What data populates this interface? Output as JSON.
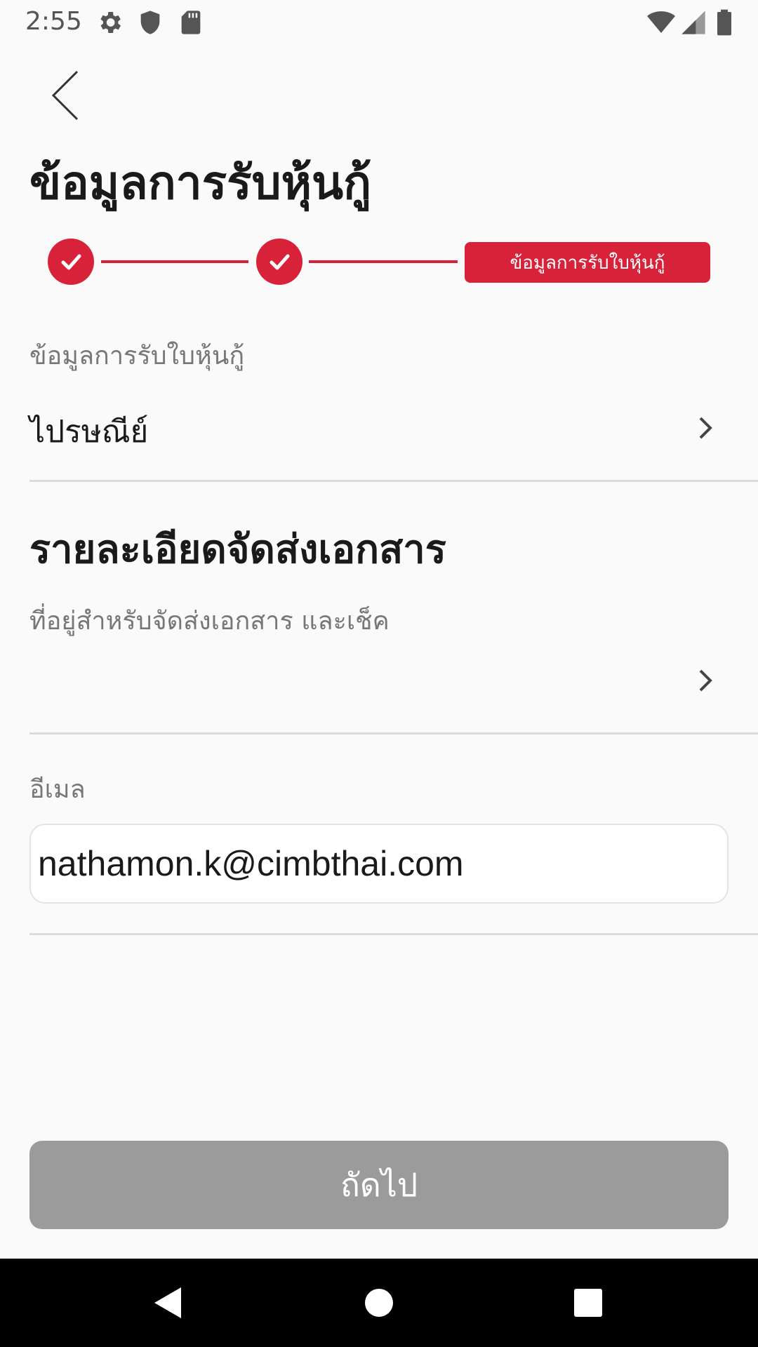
{
  "status_bar": {
    "time": "2:55",
    "left_icons": [
      "gear-icon",
      "shield-icon",
      "sd-card-icon"
    ],
    "right_icons": [
      "wifi-icon",
      "signal-icon",
      "battery-icon"
    ]
  },
  "header": {
    "back_icon": "chevron-left-icon",
    "title": "ข้อมูลการรับหุ้นกู้"
  },
  "stepper": {
    "completed_steps": 2,
    "current_step_label": "ข้อมูลการรับใบหุ้นกู้",
    "accent_color": "#d7223a"
  },
  "certificate_receipt": {
    "label": "ข้อมูลการรับใบหุ้นกู้",
    "value": "ไปรษณีย์"
  },
  "delivery_section": {
    "title": "รายละเอียดจัดส่งเอกสาร",
    "address_label": "ที่อยู่สำหรับจัดส่งเอกสาร และเช็ค",
    "address_value": ""
  },
  "email": {
    "label": "อีเมล",
    "value": "nathamon.k@cimbthai.com"
  },
  "next_button": {
    "label": "ถัดไป",
    "color": "#9b9b9b"
  },
  "nav_bar": {
    "icons": [
      "back-triangle-icon",
      "home-circle-icon",
      "recents-square-icon"
    ]
  }
}
